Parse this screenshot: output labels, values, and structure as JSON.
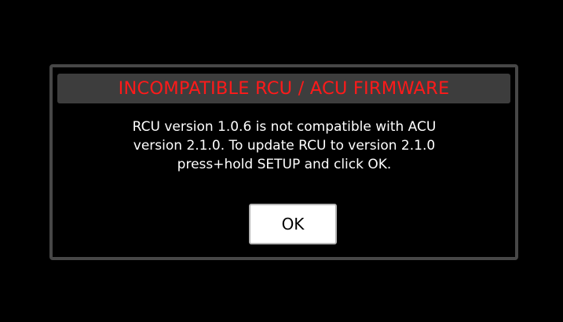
{
  "dialog": {
    "title": "INCOMPATIBLE RCU / ACU FIRMWARE",
    "message_lines": [
      "RCU version 1.0.6 is not compatible with ACU",
      "version 2.1.0.  To update RCU to version 2.1.0",
      "press+hold SETUP and click OK."
    ],
    "ok_label": "OK"
  },
  "colors": {
    "background": "#000000",
    "dialog_border": "#474747",
    "title_bar": "#3d3d3d",
    "title_text": "#ff1a1a",
    "message_text": "#ffffff",
    "button_fill": "#ffffff"
  }
}
